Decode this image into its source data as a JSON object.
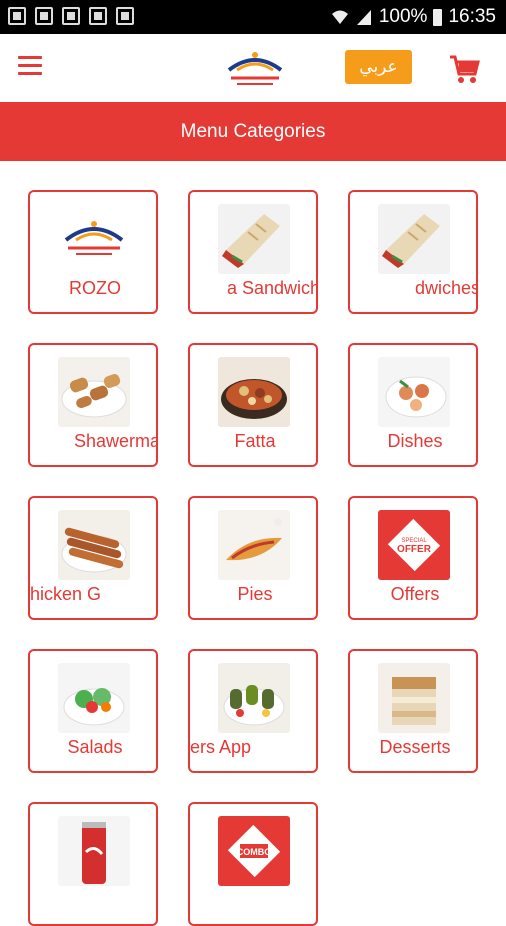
{
  "status_bar": {
    "battery": "100%",
    "time": "16:35"
  },
  "app_bar": {
    "language_button": "عربي"
  },
  "header": {
    "title": "Menu Categories"
  },
  "categories": [
    {
      "label": "ROZO",
      "icon": "logo-icon"
    },
    {
      "label": "a Sandwich",
      "icon": "wrap-sandwich-icon"
    },
    {
      "label": "dwiches",
      "icon": "wrap-sandwich-icon"
    },
    {
      "label": "Shawerma",
      "icon": "shawerma-plate-icon"
    },
    {
      "label": "Fatta",
      "icon": "fatta-dish-icon"
    },
    {
      "label": "Dishes",
      "icon": "dishes-icon"
    },
    {
      "label": "hicken     G",
      "icon": "grill-chicken-icon"
    },
    {
      "label": "Pies",
      "icon": "pie-icon"
    },
    {
      "label": "Offers",
      "icon": "offer-icon"
    },
    {
      "label": "Salads",
      "icon": "salad-icon"
    },
    {
      "label": "ers     App",
      "icon": "appetizers-icon"
    },
    {
      "label": "Desserts",
      "icon": "dessert-icon"
    },
    {
      "label": "",
      "icon": "cola-can-icon"
    },
    {
      "label": "",
      "icon": "combo-icon"
    }
  ],
  "badges": {
    "offer_top": "SPECIAL",
    "offer_main": "OFFER",
    "combo": "COMBO"
  },
  "colors": {
    "accent": "#e53935",
    "language_button": "#f59c1a"
  }
}
